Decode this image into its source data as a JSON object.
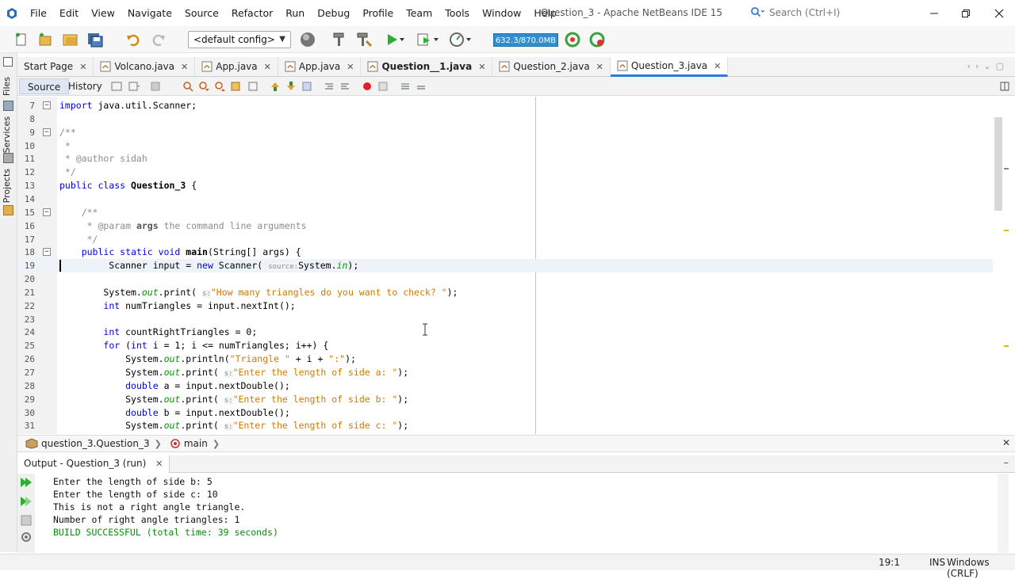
{
  "menubar": {
    "items": [
      "File",
      "Edit",
      "View",
      "Navigate",
      "Source",
      "Refactor",
      "Run",
      "Debug",
      "Profile",
      "Team",
      "Tools",
      "Window",
      "Help"
    ],
    "title": "Question_3 - Apache NetBeans IDE 15",
    "search_placeholder": "Search (Ctrl+I)"
  },
  "toolbar": {
    "config": "<default config>",
    "memory": "632.3/870.0MB"
  },
  "side_panels": [
    "Files",
    "Services",
    "Projects"
  ],
  "editor_tabs": [
    {
      "label": "Start Page",
      "bold": false,
      "active": false
    },
    {
      "label": "Volcano.java",
      "bold": false,
      "active": false
    },
    {
      "label": "App.java",
      "bold": false,
      "active": false
    },
    {
      "label": "App.java",
      "bold": false,
      "active": false
    },
    {
      "label": "Question__1.java",
      "bold": true,
      "active": false
    },
    {
      "label": "Question_2.java",
      "bold": false,
      "active": false
    },
    {
      "label": "Question_3.java",
      "bold": false,
      "active": true
    }
  ],
  "editor_subtabs": {
    "source": "Source",
    "history": "History"
  },
  "code_lines": [
    {
      "n": "7",
      "html": "<span class=\"kw\">import</span> java.util.Scanner;",
      "fold": "minus"
    },
    {
      "n": "8",
      "html": ""
    },
    {
      "n": "9",
      "html": "<span class=\"cm\">/**</span>",
      "fold": "minus"
    },
    {
      "n": "10",
      "html": "<span class=\"cm\"> *</span>"
    },
    {
      "n": "11",
      "html": "<span class=\"cm\"> * @author sidah</span>"
    },
    {
      "n": "12",
      "html": "<span class=\"cm\"> */</span>"
    },
    {
      "n": "13",
      "html": "<span class=\"kw\">public class</span> <span class=\"fn\">Question_3</span> {"
    },
    {
      "n": "14",
      "html": ""
    },
    {
      "n": "15",
      "html": "    <span class=\"cm\">/**</span>",
      "fold": "minus"
    },
    {
      "n": "16",
      "html": "<span class=\"cm\">     * @param </span><span class=\"cm\" style=\"color:#555;font-weight:bold\">args</span><span class=\"cm\"> the command line arguments</span>"
    },
    {
      "n": "17",
      "html": "<span class=\"cm\">     */</span>"
    },
    {
      "n": "18",
      "html": "    <span class=\"kw\">public static void</span> <span class=\"fn\">main</span>(String[] args) {",
      "fold": "minus"
    },
    {
      "n": "19",
      "html": "         Scanner input = <span class=\"kw\">new</span> Scanner( <span class=\"hint\">source:</span>System.<span class=\"fld\">in</span>);",
      "current": true
    },
    {
      "n": "20",
      "html": ""
    },
    {
      "n": "21",
      "html": "        System.<span class=\"fld\">out</span>.print( <span class=\"hint\">s:</span><span class=\"str\">\"How many triangles do you want to check? \"</span>);"
    },
    {
      "n": "22",
      "html": "        <span class=\"kw\">int</span> numTriangles = input.nextInt();"
    },
    {
      "n": "23",
      "html": ""
    },
    {
      "n": "24",
      "html": "        <span class=\"kw\">int</span> countRightTriangles = 0;"
    },
    {
      "n": "25",
      "html": "        <span class=\"kw\">for</span> (<span class=\"kw\">int</span> i = 1; i &lt;= numTriangles; i++) {"
    },
    {
      "n": "26",
      "html": "            System.<span class=\"fld\">out</span>.println(<span class=\"str\">\"Triangle \"</span> + i + <span class=\"str\">\":\"</span>);"
    },
    {
      "n": "27",
      "html": "            System.<span class=\"fld\">out</span>.print( <span class=\"hint\">s:</span><span class=\"str\">\"Enter the length of side a: \"</span>);"
    },
    {
      "n": "28",
      "html": "            <span class=\"kw\">double</span> a = input.nextDouble();"
    },
    {
      "n": "29",
      "html": "            System.<span class=\"fld\">out</span>.print( <span class=\"hint\">s:</span><span class=\"str\">\"Enter the length of side b: \"</span>);"
    },
    {
      "n": "30",
      "html": "            <span class=\"kw\">double</span> b = input.nextDouble();"
    },
    {
      "n": "31",
      "html": "            System.<span class=\"fld\">out</span>.print( <span class=\"hint\">s:</span><span class=\"str\">\"Enter the length of side c: \"</span>);"
    }
  ],
  "breadcrumb": {
    "class_path": "question_3.Question_3",
    "method": "main"
  },
  "output": {
    "tab_label": "Output - Question_3 (run)",
    "lines": [
      {
        "text": "Enter the length of side b: 5",
        "success": false
      },
      {
        "text": "Enter the length of side c: 10",
        "success": false
      },
      {
        "text": "This is not a right angle triangle.",
        "success": false
      },
      {
        "text": "Number of right angle triangles: 1",
        "success": false
      },
      {
        "text": "BUILD SUCCESSFUL (total time: 39 seconds)",
        "success": true
      }
    ]
  },
  "statusbar": {
    "position": "19:1",
    "mode": "INS",
    "line_endings": "Windows (CRLF)"
  }
}
